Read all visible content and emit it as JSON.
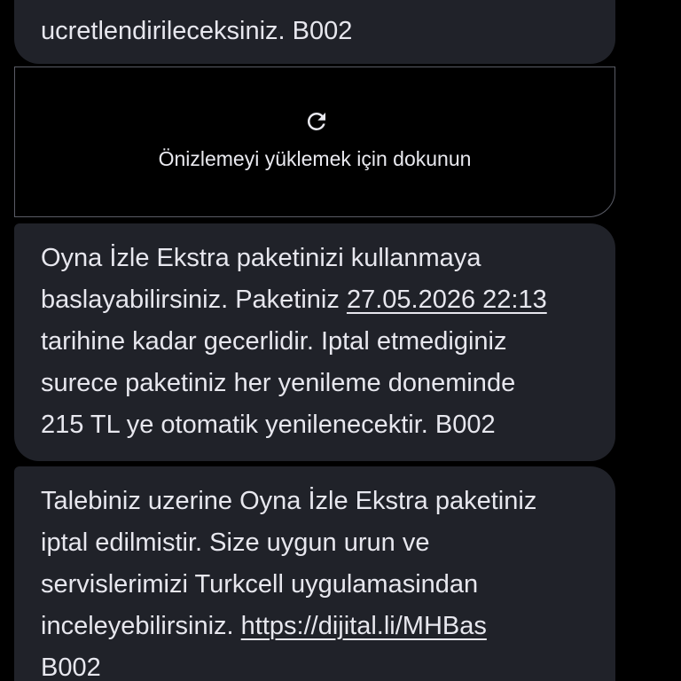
{
  "messages": [
    {
      "lines": [
        "ucretlendirileceksiniz. B002"
      ]
    },
    {
      "lines": [
        "Oyna İzle Ekstra paketinizi kullanmaya",
        "baslayabilirsiniz. Paketiniz ",
        "tarihine kadar gecerlidir. Iptal etmediginiz",
        "surece paketiniz her yenileme doneminde",
        "215 TL ye otomatik yenilenecektir. B002"
      ],
      "date_link": "27.05.2026 22:13"
    },
    {
      "lines": [
        "Talebiniz uzerine Oyna İzle Ekstra paketiniz",
        "iptal edilmistir. Size uygun urun ve",
        "servislerimizi Turkcell uygulamasindan",
        "inceleyebilirsiniz. ",
        "B002"
      ],
      "url_link": "https://dijital.li/MHBas"
    }
  ],
  "preview": {
    "icon": "refresh-icon",
    "label": "Önizlemeyi yüklemek için dokunun"
  },
  "colors": {
    "background": "#000000",
    "bubble": "#202229",
    "text": "#e7e7ee",
    "preview_border": "#5a5c66"
  }
}
